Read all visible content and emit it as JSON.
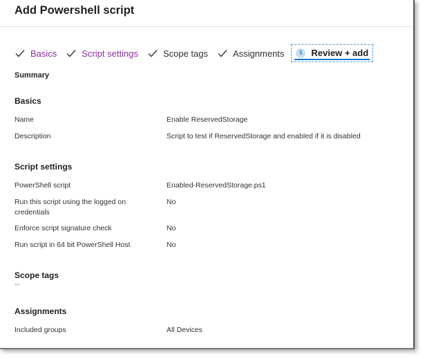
{
  "header": {
    "title": "Add Powershell script"
  },
  "wizard": {
    "steps": [
      {
        "label": "Basics",
        "state": "done"
      },
      {
        "label": "Script settings",
        "state": "done"
      },
      {
        "label": "Scope tags",
        "state": "done"
      },
      {
        "label": "Assignments",
        "state": "done"
      },
      {
        "label": "Review + add",
        "state": "current",
        "number": "5"
      }
    ]
  },
  "summary": {
    "heading": "Summary"
  },
  "basics": {
    "heading": "Basics",
    "rows": [
      {
        "label": "Name",
        "value": "Enable ReservedStorage"
      },
      {
        "label": "Description",
        "value": "Script to test if ReservedStorage and enabled if it is disabled"
      }
    ]
  },
  "script_settings": {
    "heading": "Script settings",
    "rows": [
      {
        "label": "PowerShell script",
        "value": "Enabled-ReservedStorage.ps1"
      },
      {
        "label": "Run this script using the logged on credentials",
        "value": "No"
      },
      {
        "label": "Enforce script signature check",
        "value": "No"
      },
      {
        "label": "Run script in 64 bit PowerShell Host",
        "value": "No"
      }
    ]
  },
  "scope_tags": {
    "heading": "Scope tags",
    "value": "--"
  },
  "assignments": {
    "heading": "Assignments",
    "rows": [
      {
        "label": "Included groups",
        "value": "All Devices"
      }
    ]
  },
  "colors": {
    "accent": "#0078d4",
    "visited_step": "#8c2f9f",
    "text": "#323130"
  }
}
